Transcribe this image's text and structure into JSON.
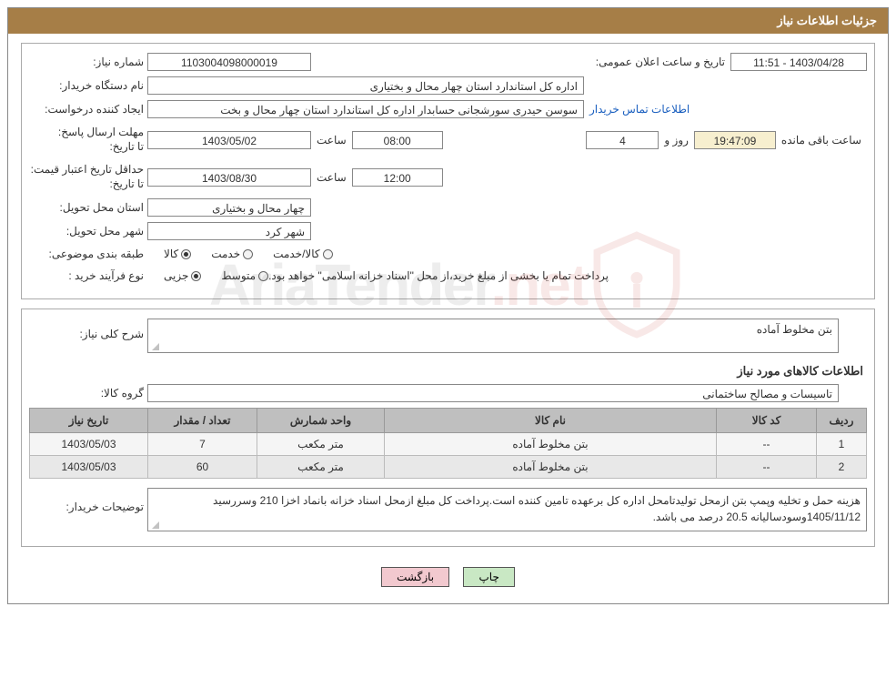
{
  "header": {
    "title": "جزئیات اطلاعات نیاز"
  },
  "fields": {
    "need_no_label": "شماره نیاز:",
    "need_no": "1103004098000019",
    "announce_label": "تاریخ و ساعت اعلان عمومی:",
    "announce_value": "1403/04/28 - 11:51",
    "buyer_org_label": "نام دستگاه خریدار:",
    "buyer_org": "اداره کل استاندارد استان چهار محال و بختیاری",
    "requester_label": "ایجاد کننده درخواست:",
    "requester": "سوسن حیدری سورشجانی حسابدار اداره کل استاندارد استان چهار محال و بخت",
    "contact_link": "اطلاعات تماس خریدار",
    "reply_deadline_label": "مهلت ارسال پاسخ:",
    "to_date_label": "تا تاریخ:",
    "reply_date": "1403/05/02",
    "time_label": "ساعت",
    "reply_time": "08:00",
    "days_count": "4",
    "days_and_label": "روز و",
    "remain_time": "19:47:09",
    "remain_label": "ساعت باقی مانده",
    "price_valid_label": "حداقل تاریخ اعتبار قیمت:",
    "price_valid_date": "1403/08/30",
    "price_valid_time": "12:00",
    "delivery_prov_label": "استان محل تحویل:",
    "delivery_prov": "چهار محال و بختیاری",
    "delivery_city_label": "شهر محل تحویل:",
    "delivery_city": "شهر کرد",
    "subject_cls_label": "طبقه بندی موضوعی:",
    "radio_goods": "کالا",
    "radio_service": "خدمت",
    "radio_goods_service": "کالا/خدمت",
    "purchase_type_label": "نوع فرآیند خرید :",
    "radio_partial": "جزیی",
    "radio_medium": "متوسط",
    "purchase_note": "پرداخت تمام یا بخشی از مبلغ خرید،از محل \"اسناد خزانه اسلامی\" خواهد بود.",
    "need_desc_label": "شرح کلی نیاز:",
    "need_desc": "بتن مخلوط آماده",
    "goods_info_header": "اطلاعات کالاهای مورد نیاز",
    "goods_group_label": "گروه کالا:",
    "goods_group": "تاسیسات و مصالح ساختمانی",
    "buyer_notes_label": "توضیحات خریدار:",
    "buyer_notes": "هزینه حمل و تخلیه وپمپ بتن ازمحل تولیدتامحل اداره کل برعهده تامین کننده است.پرداخت کل مبلغ ازمحل اسناد خزانه بانماد اخزا 210 وسررسید 1405/11/12وسودسالیانه 20.5 درصد می باشد."
  },
  "grid": {
    "headers": {
      "row": "ردیف",
      "code": "کد کالا",
      "name": "نام کالا",
      "unit": "واحد شمارش",
      "qty": "تعداد / مقدار",
      "need_date": "تاریخ نیاز"
    },
    "rows": [
      {
        "row": "1",
        "code": "--",
        "name": "بتن مخلوط آماده",
        "unit": "متر مکعب",
        "qty": "7",
        "need_date": "1403/05/03"
      },
      {
        "row": "2",
        "code": "--",
        "name": "بتن مخلوط آماده",
        "unit": "متر مکعب",
        "qty": "60",
        "need_date": "1403/05/03"
      }
    ]
  },
  "buttons": {
    "print": "چاپ",
    "back": "بازگشت"
  },
  "watermark": {
    "text_pre": "AriaTender",
    "text_dot": ".",
    "text_suf": "net"
  }
}
